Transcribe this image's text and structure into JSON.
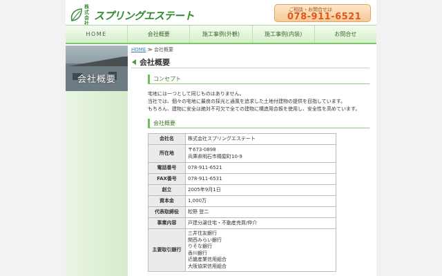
{
  "header": {
    "logo_prefix": "株式\n会社",
    "logo_name": "スプリングエステート",
    "contact_label": "ご相談・お問合せは",
    "contact_phone": "078-911-6521"
  },
  "nav": {
    "items": [
      {
        "label": "HOME"
      },
      {
        "label": "会社概要"
      },
      {
        "label": "施工事例(外観)"
      },
      {
        "label": "施工事例(内装)"
      },
      {
        "label": "お問合せ"
      }
    ]
  },
  "sidebar": {
    "title": "会社概要"
  },
  "breadcrumb": {
    "home": "HOME",
    "separator": "≫",
    "current": "会社概要"
  },
  "main": {
    "title": "会社概要",
    "concept": {
      "heading": "コンセプト",
      "lines": [
        "宅地には一つとして同じものはありません。",
        "当社では、個々の宅地に最良の採光と通風を追求した土地付建物の提供を目指しています。",
        "もちろん、建物に安全は絶対不可欠で全ての建物に構造用合板を使用し、安全性を高めています。"
      ]
    },
    "overview": {
      "heading": "会社概要",
      "rows": [
        {
          "label": "会社名",
          "value": [
            "株式会社スプリングエステート"
          ]
        },
        {
          "label": "所在地",
          "value": [
            "〒673-0898",
            "兵庫県明石市樽屋町10-9"
          ]
        },
        {
          "label": "電話番号",
          "value": [
            "078-911-6521"
          ]
        },
        {
          "label": "FAX番号",
          "value": [
            "078-911-6531"
          ]
        },
        {
          "label": "創立",
          "value": [
            "2005年9月1日"
          ]
        },
        {
          "label": "資本金",
          "value": [
            "1,000万"
          ]
        },
        {
          "label": "代表取締役",
          "value": [
            "松野 登二"
          ]
        },
        {
          "label": "事業内容",
          "value": [
            "戸建分譲住宅・不動産売買/仲介"
          ]
        },
        {
          "label": "主要取引銀行",
          "value": [
            "三井住友銀行",
            "関西みらい銀行",
            "りそな銀行",
            "香川銀行",
            "近畿産業信用組合",
            "大阪協栄信用組合"
          ]
        }
      ]
    }
  }
}
